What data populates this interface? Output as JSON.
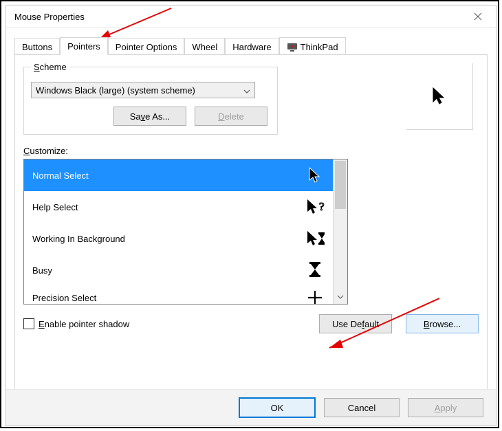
{
  "window": {
    "title": "Mouse Properties"
  },
  "tabs": [
    {
      "label": "Buttons"
    },
    {
      "label": "Pointers"
    },
    {
      "label": "Pointer Options"
    },
    {
      "label": "Wheel"
    },
    {
      "label": "Hardware"
    },
    {
      "label": "ThinkPad"
    }
  ],
  "scheme": {
    "legend_s": "S",
    "legend_rest": "cheme",
    "selected": "Windows Black (large) (system scheme)",
    "save_pre": "Sa",
    "save_u": "v",
    "save_post": "e As...",
    "delete_u": "D",
    "delete_rest": "elete"
  },
  "customize": {
    "label_u": "C",
    "label_rest": "ustomize:",
    "items": [
      {
        "label": "Normal Select",
        "icon": "cursor"
      },
      {
        "label": "Help Select",
        "icon": "cursor-help"
      },
      {
        "label": "Working In Background",
        "icon": "cursor-busy"
      },
      {
        "label": "Busy",
        "icon": "hourglass"
      },
      {
        "label": "Precision Select",
        "icon": "crosshair"
      }
    ]
  },
  "options": {
    "shadow_u": "E",
    "shadow_rest": "nable pointer shadow",
    "usedefault_pre": "Use De",
    "usedefault_u": "f",
    "usedefault_post": "ault",
    "browse_u": "B",
    "browse_rest": "rowse..."
  },
  "footer": {
    "ok": "OK",
    "cancel": "Cancel",
    "apply_u": "A",
    "apply_rest": "pply"
  }
}
